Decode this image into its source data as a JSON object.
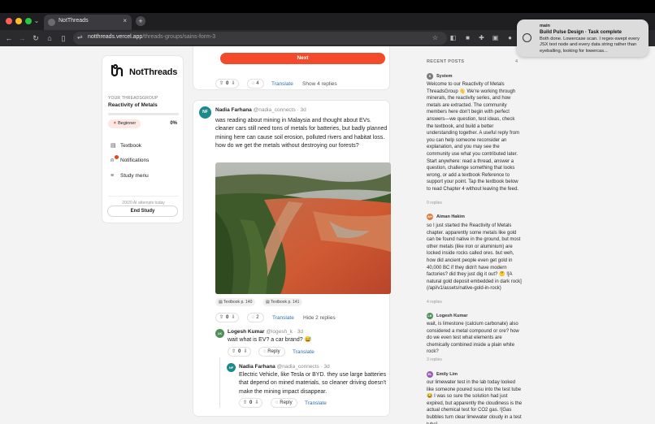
{
  "browser": {
    "tab_title": "NotThreads",
    "tab_close": "×",
    "new_tab": "+",
    "tab_dropdown": "⌄",
    "url_domain": "notthreads.vercel.app",
    "url_path": "/threads-groups/sains-form-3",
    "nav_icons": [
      "back-icon",
      "forward-icon",
      "reload-icon",
      "home-icon",
      "sidebar-icon"
    ],
    "ext_icons": [
      "star-icon",
      "extension-icon",
      "camera-icon",
      "puzzle-icon",
      "tab-search-icon"
    ]
  },
  "sidebar": {
    "logo": "NotThreads",
    "group_label": "YOUR THREADSGROUP",
    "group_name": "Reactivity of Metals",
    "progress": 0,
    "level_badge": "Beginner",
    "percent": "0%",
    "items": [
      {
        "label": "Textbook",
        "icon": "book-icon"
      },
      {
        "label": "Notifications",
        "icon": "bell-icon"
      },
      {
        "label": "Study menu",
        "icon": "menu-icon"
      }
    ],
    "ai_attempts": "20/20 AI attempts today",
    "end_button": "End Study"
  },
  "feed": {
    "top": {
      "next_label": "Next",
      "up": "0",
      "comments": "4",
      "translate": "Translate",
      "show_replies": "Show 4 replies"
    },
    "post": {
      "avatar": "NF",
      "name": "Nadia Farhana",
      "handle": "@nadia_connects",
      "time": "· 3d",
      "body": "was reading about mining in Malaysia and thought about EVs. cleaner cars still need tons of metals for batteries, but badly planned mining here can cause soil erosion, polluted rivers and habitat loss. how do we get the metals without destroying our forests?",
      "chips": [
        "Textbook p. 140",
        "Textbook p. 141"
      ],
      "up": "0",
      "comments": "2",
      "translate": "Translate",
      "hide_replies": "Hide 2 replies"
    },
    "reply1": {
      "avatar": "LK",
      "name": "Logesh Kumar",
      "handle": "@logesh_k",
      "time": "· 3d",
      "body": "wait what is EV? a car brand? 😅",
      "up": "0",
      "reply": "Reply",
      "translate": "Translate"
    },
    "reply2": {
      "avatar": "NF",
      "name": "Nadia Farhana",
      "handle": "@nadia_connects",
      "time": "· 3d",
      "body": "Electric Vehicle, like Tesla or BYD. they use large batteries that depend on mined materials, so cleaner driving doesn't make the mining impact disappear.",
      "up": "0",
      "reply": "Reply",
      "translate": "Translate"
    }
  },
  "recent": {
    "header": "RECENT POSTS",
    "count": "4",
    "posts": [
      {
        "avatar": "S",
        "avatar_color": "#7a7a7a",
        "name": "System",
        "text": "Welcome to our Reactivity of Metals ThreadsGroup 👋 We're working through minerals, the reactivity series, and how metals are extracted. The community members here don't begin with perfect answers—we question, test ideas, check the textbook, and build a better understanding together. A useful reply from you can help someone reconsider an explanation, and you may see the community use what you contributed later. Start anywhere: read a thread, answer a question, challenge something that looks wrong, or add a textbook Reference to support your point. Tap the textbook below to read Chapter 4 without leaving the feed.",
        "replies": "0 replies"
      },
      {
        "avatar": "AH",
        "avatar_color": "#e07a3c",
        "name": "Aiman Hakim",
        "text": "so I just started the Reactivity of Metals chapter. apparently some metals like gold can be found native in the ground, but most other metals (like iron or aluminium) are locked inside rocks called ores. but weh, how did ancient people even get gold in 40,000 BC if they didn't have modern factories? did they just dig it out? 🤔 ![A natural gold deposit embedded in dark rock](/api/v1/assets/native-gold-in-rock)",
        "replies": "4 replies"
      },
      {
        "avatar": "LK",
        "avatar_color": "#4f8f5a",
        "name": "Logesh Kumar",
        "text": "wait, is limestone (calcium carbonate) also considered a metal compound or ore? how do we even test what elements are chemically combined inside a plain white rock?",
        "replies": "3 replies"
      },
      {
        "avatar": "EL",
        "avatar_color": "#9b59b6",
        "name": "Emily Lim",
        "text": "our limewater test in the lab today looked like someone poured susu into the test tube 😂 I was so sure the solution had just expired, but apparently the cloudiness is the actual chemical test for CO2 gas. ![Gas bubbles turn clear limewater cloudy in a test tube]",
        "replies": ""
      }
    ]
  },
  "toast": {
    "app": "main",
    "title": "Build Pulse Design · Task complete",
    "body": "Both done. Lowercase scan. I regex-swept every JSX text node and every data string rather than eyeballing, looking for lowercas..."
  },
  "colors": {
    "accent": "#f24a2b",
    "link": "#2f6fb5",
    "avatar_teal": "#1c8a8a",
    "avatar_green": "#4f8f5a"
  }
}
